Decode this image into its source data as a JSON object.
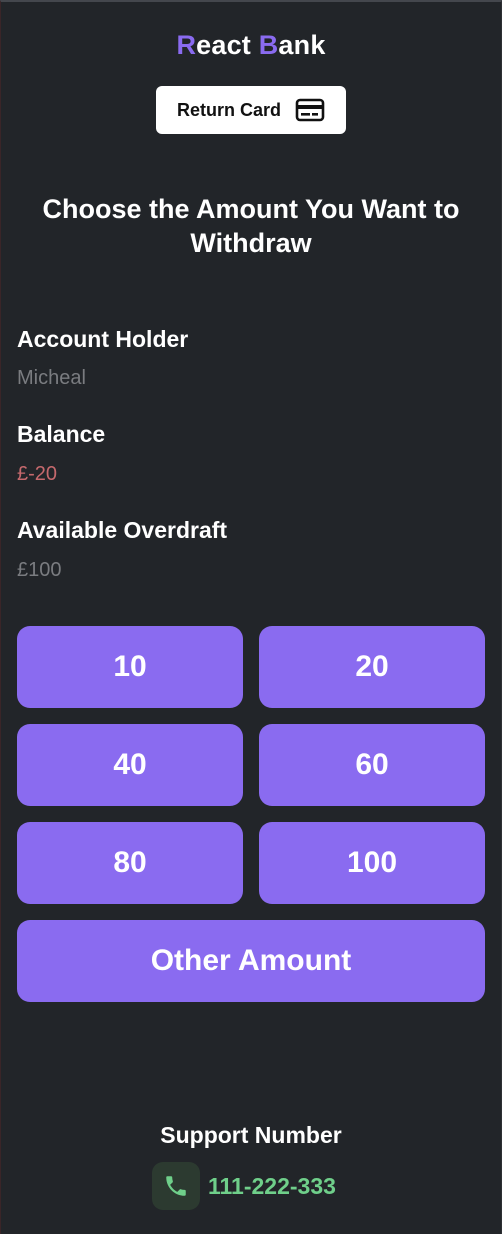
{
  "brand": {
    "r_letter": "R",
    "react_rest": "eact ",
    "b_letter": "B",
    "bank_rest": "ank"
  },
  "header": {
    "return_card_label": "Return Card"
  },
  "main": {
    "heading": "Choose the Amount You Want to Withdraw",
    "account_holder_label": "Account Holder",
    "account_holder_value": "Micheal",
    "balance_label": "Balance",
    "balance_value": "£-20",
    "overdraft_label": "Available Overdraft",
    "overdraft_value": "£100",
    "amounts": [
      "10",
      "20",
      "40",
      "60",
      "80",
      "100"
    ],
    "other_amount_label": "Other Amount"
  },
  "footer": {
    "support_title": "Support Number",
    "support_number": "111-222-333"
  },
  "colors": {
    "background": "#222529",
    "accent": "#8a6bf0",
    "negative": "#c5696d",
    "muted": "#7a7c80",
    "phone_green": "#6fcf8a"
  }
}
